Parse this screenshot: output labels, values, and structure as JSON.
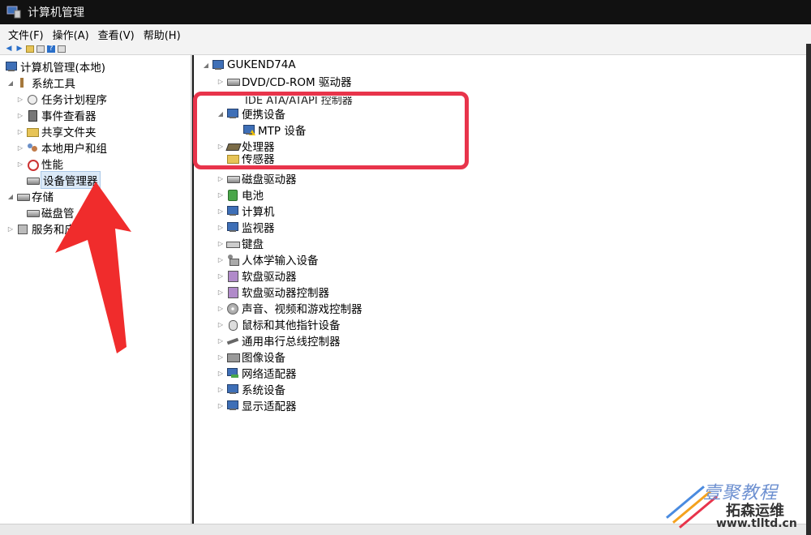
{
  "window": {
    "title": "计算机管理"
  },
  "menu": [
    "文件(F)",
    "操作(A)",
    "查看(V)",
    "帮助(H)"
  ],
  "left_tree": {
    "root": "计算机管理(本地)",
    "system_tools": "系统工具",
    "task_scheduler": "任务计划程序",
    "event_viewer": "事件查看器",
    "shared_folders": "共享文件夹",
    "local_users": "本地用户和组",
    "performance": "性能",
    "device_manager": "设备管理器",
    "storage": "存储",
    "disk_management": "磁盘管",
    "services": "服务和应"
  },
  "device_tree": {
    "computer": "GUKEND74A",
    "dvd": "DVD/CD-ROM 驱动器",
    "ide_partial": "IDE ATA/ATAPI 控制器",
    "portable": "便携设备",
    "mtp": "MTP 设备",
    "processor": "处理器",
    "sensor_partial": "传感器",
    "categories": [
      "磁盘驱动器",
      "电池",
      "计算机",
      "监视器",
      "键盘",
      "人体学输入设备",
      "软盘驱动器",
      "软盘驱动器控制器",
      "声音、视频和游戏控制器",
      "鼠标和其他指针设备",
      "通用串行总线控制器",
      "图像设备",
      "网络适配器",
      "系统设备",
      "显示适配器"
    ],
    "category_icons": [
      "disk-icon",
      "battery-icon",
      "computer-icon",
      "monitor-icon",
      "keyboard-icon",
      "hid-icon",
      "floppy-icon",
      "floppy-controller-icon",
      "sound-icon",
      "mouse-icon",
      "usb-icon",
      "camera-icon",
      "network-icon",
      "system-icon",
      "display-icon"
    ]
  },
  "watermark": {
    "line1": "壹聚教程",
    "line2": "拓森运维",
    "url": "www.tlltd.cn"
  },
  "colors": {
    "highlight": "#e8344b",
    "arrow": "#f02c2c"
  }
}
